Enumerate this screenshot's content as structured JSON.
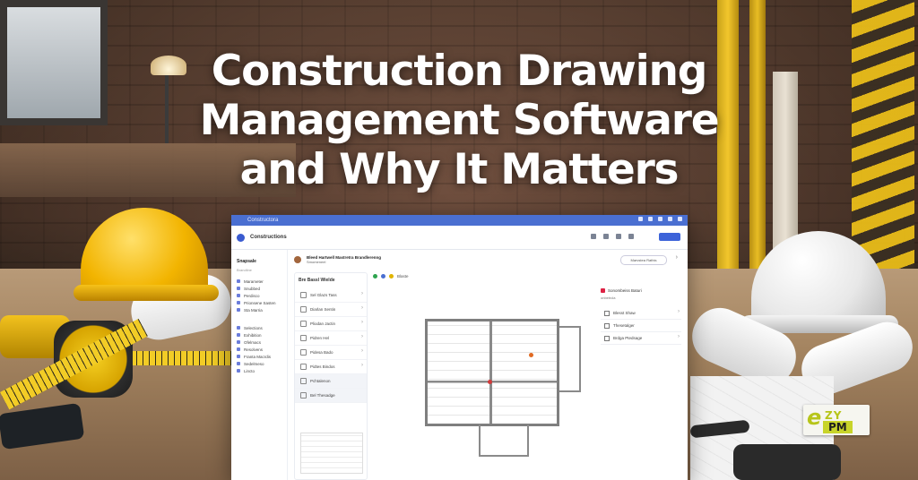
{
  "headline": {
    "line1": "Construction Drawing",
    "line2": "Management Software",
    "line3": "and Why It Matters"
  },
  "logo": {
    "mark": "e",
    "zy": "ZY",
    "pm": "PM",
    "accent_color": "#b7c51a"
  },
  "app": {
    "titlebar": {
      "brand": "Constructora",
      "color": "#4a6fd1"
    },
    "topbar": {
      "title": "Constructions",
      "primary_button": ""
    },
    "sidebar": {
      "heading": "Snapsale",
      "subheading": "Brandline",
      "items_top": [
        "Marameter",
        "Snubbed",
        "Perdisco",
        "Prionsene Sasten",
        "Sta Marria"
      ],
      "items_bottom": [
        "Selections",
        "Exhibition",
        "Ofelmacs",
        "Resolvens",
        "Franta Macrdis",
        "Sedelmeso",
        "Lincto"
      ]
    },
    "header": {
      "line1": "Bleed Hartwell Mastretra Brandlerenng",
      "line2": "Smomeneel"
    },
    "search_pill": "Marvstea Rathis",
    "list_panel": {
      "title": "Bre Bassl Wielde",
      "rows": [
        "Sel Glazs Tass",
        "Diarlan Sentin",
        "Pliodan Jactin",
        "Pidren Hel",
        "Pidesa Bado",
        "Pidtes Bindos"
      ],
      "selected_rows": [
        "Pchtalenon",
        "Bel Thesadge"
      ]
    },
    "canvas": {
      "tool_label": "Blaste"
    },
    "right_panel": {
      "heading": "Sonombeiss Baturi",
      "sub": "onbetrcla",
      "rows": [
        "Blesst Shaw",
        "Thesetalger",
        "Brdga Ptedsage"
      ]
    },
    "accent_color": "#3d63d9"
  }
}
